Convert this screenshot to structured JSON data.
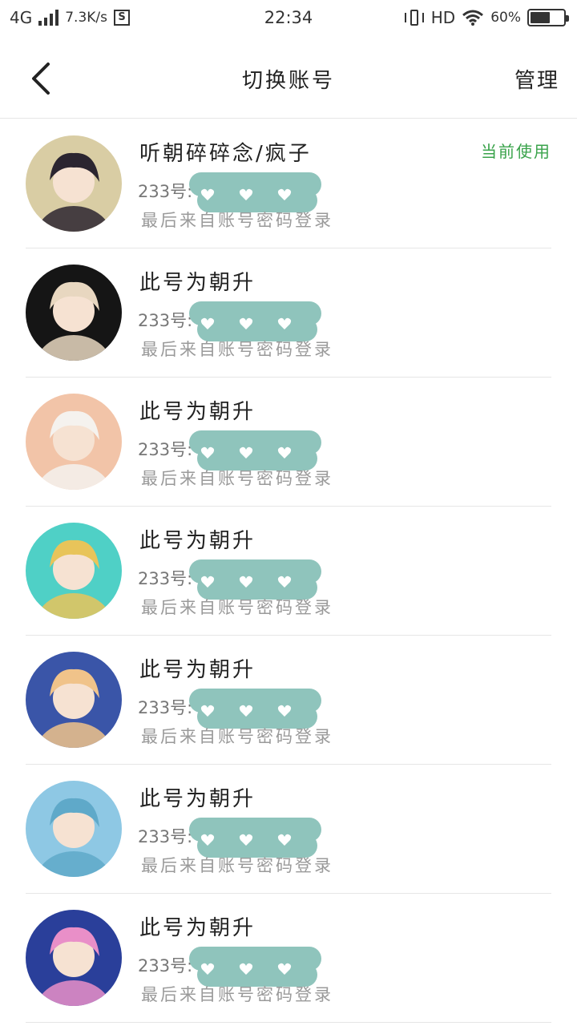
{
  "status_bar": {
    "network": "4G",
    "speed": "7.3K/s",
    "sim_badge": "S",
    "time": "22:34",
    "hd": "HD",
    "battery_percent": "60%",
    "battery_level": 0.6
  },
  "header": {
    "back_icon": "chevron-left-icon",
    "title": "切换账号",
    "manage_label": "管理"
  },
  "colors": {
    "accent_green": "#3aa34b",
    "redaction_teal": "#8fc4bc"
  },
  "accounts": [
    {
      "name": "听朝碎碎念/疯子",
      "id_label": "233号:",
      "last_login": "最后来自账号密码登录",
      "current_label": "当前使用",
      "avatar_bg": "#d9cda4",
      "avatar_fg": "#2b2530"
    },
    {
      "name": "此号为朝升",
      "id_label": "233号:",
      "last_login": "最后来自账号密码登录",
      "current_label": "",
      "avatar_bg": "#151515",
      "avatar_fg": "#e8d7c0"
    },
    {
      "name": "此号为朝升",
      "id_label": "233号:",
      "last_login": "最后来自账号密码登录",
      "current_label": "",
      "avatar_bg": "#f2c4a8",
      "avatar_fg": "#f5f2ee"
    },
    {
      "name": "此号为朝升",
      "id_label": "233号:",
      "last_login": "最后来自账号密码登录",
      "current_label": "",
      "avatar_bg": "#4fd0c6",
      "avatar_fg": "#e8c45a"
    },
    {
      "name": "此号为朝升",
      "id_label": "233号:",
      "last_login": "最后来自账号密码登录",
      "current_label": "",
      "avatar_bg": "#3a55a8",
      "avatar_fg": "#f0c38a"
    },
    {
      "name": "此号为朝升",
      "id_label": "233号:",
      "last_login": "最后来自账号密码登录",
      "current_label": "",
      "avatar_bg": "#8ec8e4",
      "avatar_fg": "#5fa9c9"
    },
    {
      "name": "此号为朝升",
      "id_label": "233号:",
      "last_login": "最后来自账号密码登录",
      "current_label": "",
      "avatar_bg": "#2a3f9a",
      "avatar_fg": "#e98fc8"
    }
  ]
}
